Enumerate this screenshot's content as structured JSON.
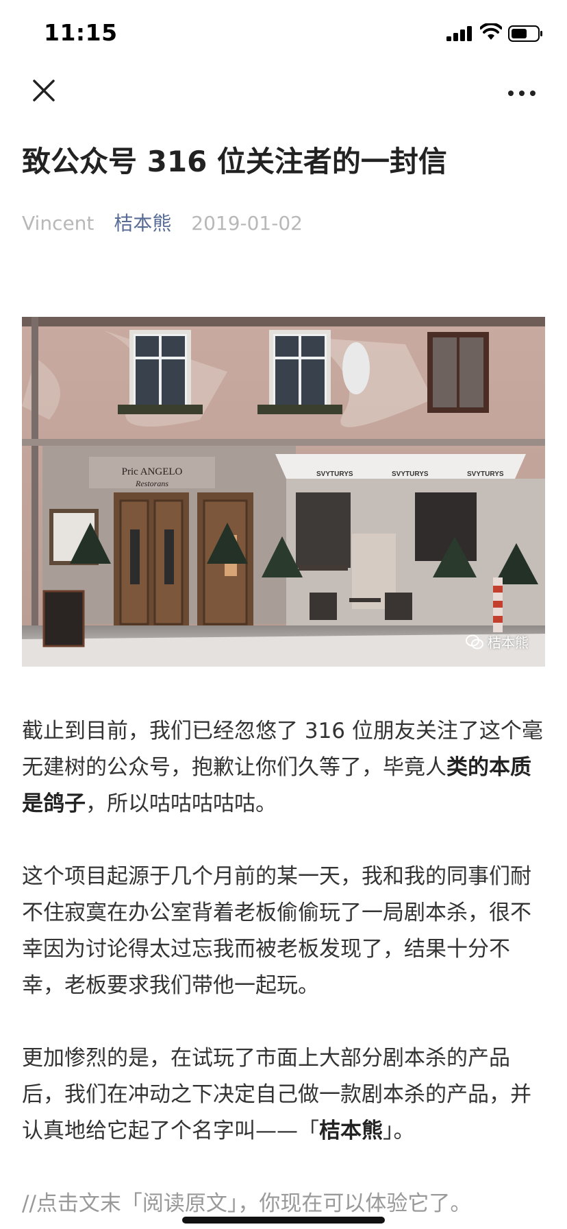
{
  "status_bar": {
    "time": "11:15"
  },
  "nav": {
    "close_icon": "close-icon",
    "more_icon": "more-icon"
  },
  "article": {
    "title": "致公众号 316 位关注者的一封信",
    "author": "Vincent",
    "account": "桔本熊",
    "date": "2019-01-02",
    "cover_sign": "Pric ANGELO",
    "cover_sign_sub": "Restorans",
    "cover_awning": "SVYTURYS",
    "cover_watermark": "桔本熊",
    "paragraphs": {
      "p1_a": "截止到目前，我们已经忽悠了 316 位朋友关注了这个毫无建树的公众号，抱歉让你们久等了，毕竟人",
      "p1_bold": "类的本质是鸽子",
      "p1_c": "，所以咕咕咕咕咕。",
      "p2": "这个项目起源于几个月前的某一天，我和我的同事们耐不住寂寞在办公室背着老板偷偷玩了一局剧本杀，很不幸因为讨论得太过忘我而被老板发现了，结果十分不幸，老板要求我们带他一起玩。",
      "p3_a": "更加惨烈的是，在试玩了市面上大部分剧本杀的产品后，我们在冲动之下决定自己做一款剧本杀的产品，并认真地给它起了个名字叫——「",
      "p3_bold": "桔本熊",
      "p3_c": "」。",
      "p4": "//点击文末「阅读原文」，你现在可以体验它了。"
    }
  },
  "colors": {
    "account_link": "#576b95",
    "meta_gray": "#b8b8b8",
    "body_text": "#333333"
  }
}
